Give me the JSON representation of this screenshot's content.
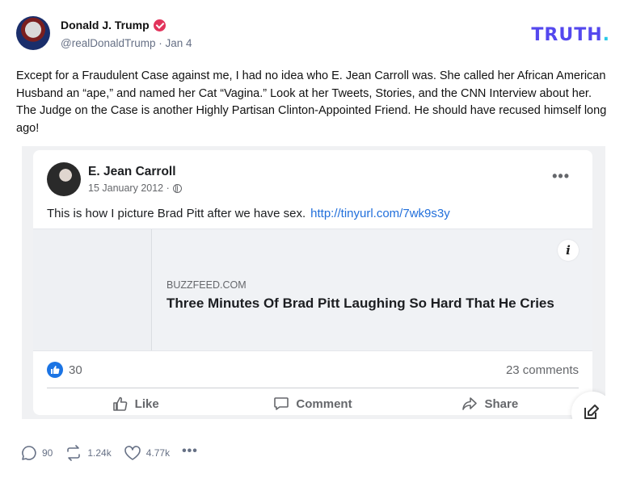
{
  "post": {
    "author_name": "Donald J. Trump",
    "handle": "@realDonaldTrump",
    "separator": "·",
    "date": "Jan 4",
    "text": "Except for a Fraudulent Case against me, I had no idea who E. Jean Carroll was. She called her African American Husband an “ape,” and named her Cat “Vagina.” Look at her Tweets, Stories, and the CNN Interview about her. The Judge on the Case is another Highly Partisan Clinton-Appointed Friend. He should have recused himself long ago!",
    "icons": {
      "verified": "verified-badge-icon",
      "avatar": "flag-portrait-avatar"
    }
  },
  "brand": {
    "logo_text": "TRUTH",
    "logo_dot": ".",
    "colors": {
      "logo": "#5448ee",
      "dot": "#29c9e6",
      "verified": "#e2335b"
    }
  },
  "embedded_fb_post": {
    "author_name": "E. Jean Carroll",
    "date": "15 January 2012 ·",
    "more_label": "•••",
    "text": "This is how I picture Brad Pitt after we have sex.",
    "link": "http://tinyurl.com/7wk9s3y",
    "preview": {
      "info_label": "i",
      "domain": "BUZZFEED.COM",
      "title": "Three Minutes Of Brad Pitt Laughing So Hard That He Cries"
    },
    "reactions_count": "30",
    "comments_count": "23 comments",
    "actions": {
      "like": "Like",
      "comment": "Comment",
      "share": "Share"
    },
    "colors": {
      "like_blue": "#1b74e4",
      "link": "#216fdb"
    }
  },
  "stats": {
    "replies": "90",
    "retruths": "1.24k",
    "likes": "4.77k",
    "more": "•••"
  }
}
